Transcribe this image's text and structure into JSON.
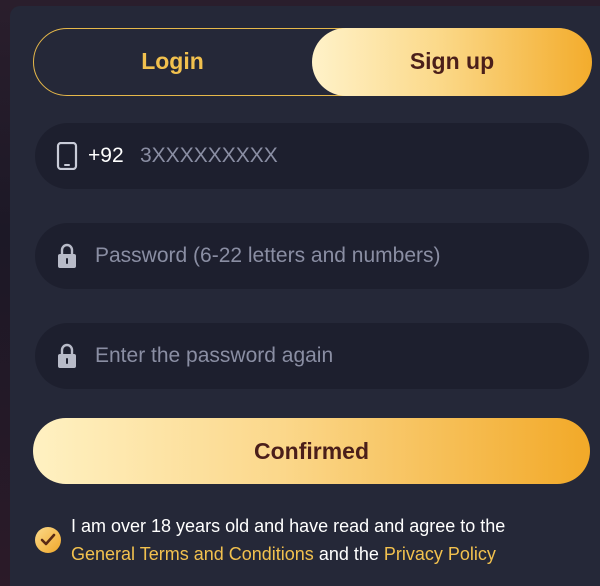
{
  "tabs": {
    "login_label": "Login",
    "signup_label": "Sign up",
    "active": "Sign up"
  },
  "phone": {
    "icon": "phone-icon",
    "country_code": "+92",
    "placeholder": "3XXXXXXXXX"
  },
  "password": {
    "icon": "lock-icon",
    "placeholder": "Password (6-22 letters and numbers)"
  },
  "password_confirm": {
    "icon": "lock-icon",
    "placeholder": "Enter the password again"
  },
  "confirm_button": {
    "label": "Confirmed"
  },
  "agreement": {
    "checked": true,
    "text_line1": "I am over 18 years old and have read and agree to the",
    "terms_link": "General Terms and Conditions",
    "and_text": " and the ",
    "privacy_link": "Privacy Policy"
  },
  "colors": {
    "accent_gold": "#f2c14e",
    "panel_bg": "#252838",
    "field_bg": "#1d1f2e",
    "button_text": "#4b1f1a"
  }
}
